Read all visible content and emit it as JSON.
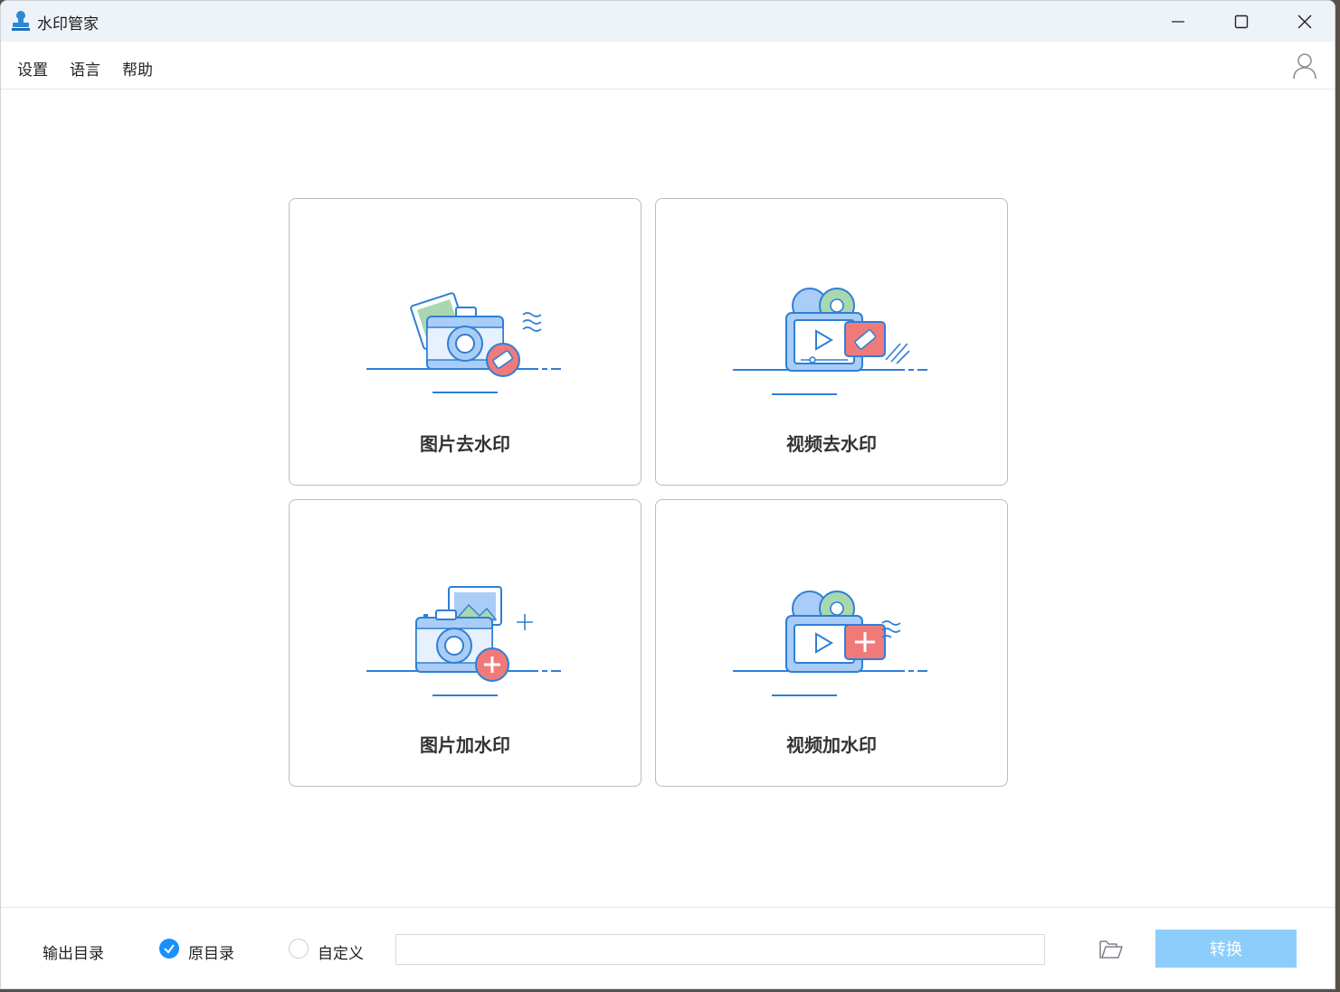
{
  "window": {
    "title": "水印管家"
  },
  "menu": {
    "settings": "设置",
    "language": "语言",
    "help": "帮助"
  },
  "cards": [
    {
      "label": "图片去水印"
    },
    {
      "label": "视频去水印"
    },
    {
      "label": "图片加水印"
    },
    {
      "label": "视频加水印"
    }
  ],
  "footer": {
    "output_label": "输出目录",
    "original_dir": "原目录",
    "custom": "自定义",
    "path_value": "",
    "convert": "转换"
  },
  "colors": {
    "accent": "#1890ff",
    "convert_disabled": "#8dcdfb",
    "illus_blue": "#2f7fd6",
    "illus_light": "#a9cdf6",
    "illus_red": "#f07a7a",
    "illus_green": "#a9d8b0"
  }
}
